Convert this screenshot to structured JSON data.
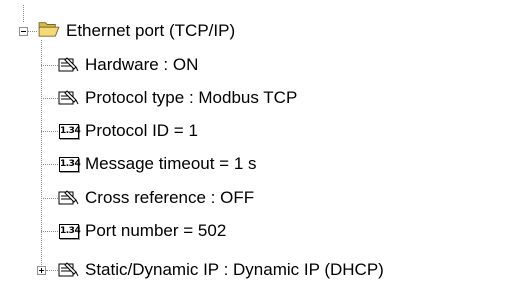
{
  "tree": {
    "root": {
      "label": "Ethernet port (TCP/IP)",
      "icon": "folder-open-icon",
      "expanded": true
    },
    "children": [
      {
        "label": "Hardware : ON",
        "icon": "parameter-icon"
      },
      {
        "label": "Protocol type : Modbus TCP",
        "icon": "parameter-icon"
      },
      {
        "label": "Protocol ID = 1",
        "icon": "numeric-value-icon",
        "badge": "1.34"
      },
      {
        "label": "Message timeout = 1 s",
        "icon": "numeric-value-icon",
        "badge": "1.34"
      },
      {
        "label": "Cross reference : OFF",
        "icon": "parameter-icon"
      },
      {
        "label": "Port number = 502",
        "icon": "numeric-value-icon",
        "badge": "1.34"
      },
      {
        "label": "Static/Dynamic IP : Dynamic IP (DHCP)",
        "icon": "parameter-icon",
        "expanded": false
      }
    ]
  },
  "colors": {
    "background": "#ffffff",
    "text": "#000000",
    "tree_lines": "#8a8a8a",
    "folder": "#e8c85a"
  }
}
